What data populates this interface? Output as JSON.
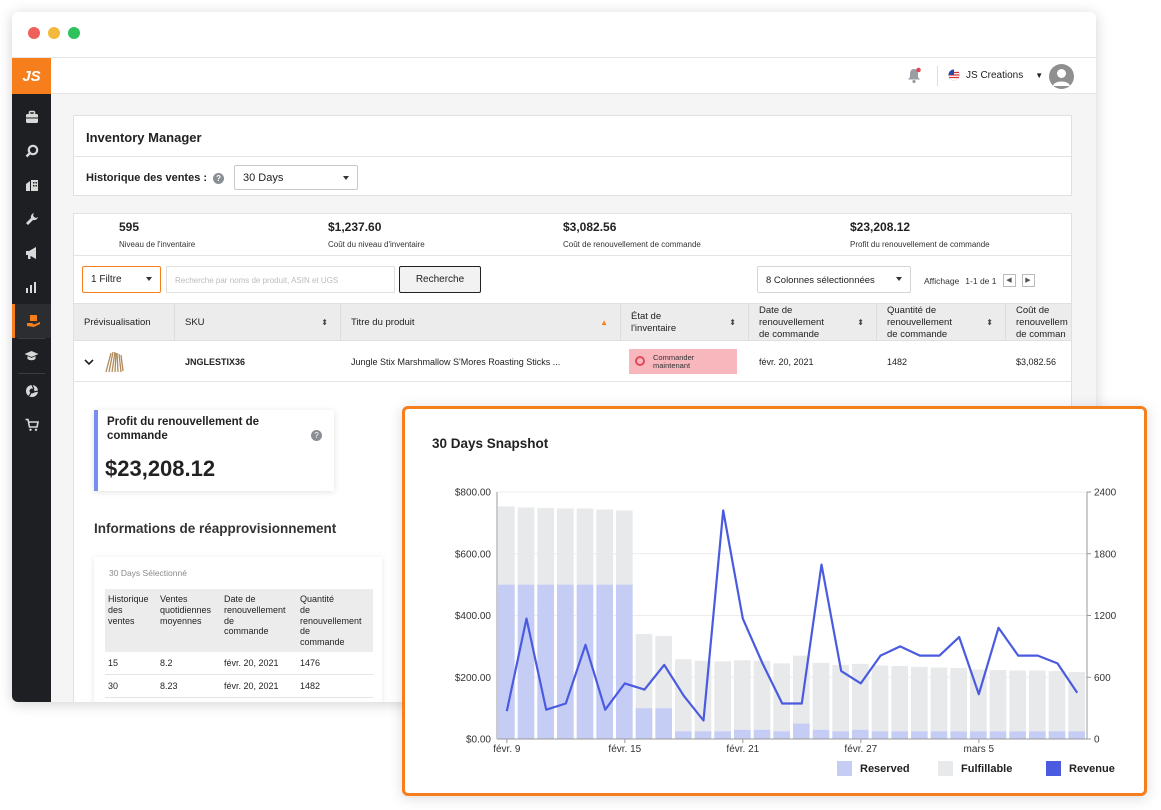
{
  "app": {
    "logo_text": "JS",
    "store_name": "JS Creations",
    "colors": {
      "accent": "#f67e1d",
      "sidebar": "#1d1f23",
      "reserved": "#c6cdf5",
      "fulfillable": "#e8e9eb",
      "revenue": "#4b5be0"
    }
  },
  "sidebar": {
    "items": [
      {
        "icon": "suitcase-icon"
      },
      {
        "icon": "search-icon"
      },
      {
        "icon": "building-icon"
      },
      {
        "icon": "wrench-icon"
      },
      {
        "icon": "megaphone-icon"
      },
      {
        "icon": "bar-chart-icon"
      },
      {
        "icon": "inventory-hand-icon",
        "active": true
      },
      {
        "icon": "graduation-cap-icon"
      },
      {
        "icon": "aperture-icon"
      },
      {
        "icon": "cart-icon"
      }
    ]
  },
  "header": {
    "title": "Inventory Manager",
    "history_label": "Historique des ventes :",
    "history_value": "30 Days"
  },
  "stats": [
    {
      "value": "595",
      "label": "Niveau de l'inventaire"
    },
    {
      "value": "$1,237.60",
      "label": "Coût du niveau d'inventaire"
    },
    {
      "value": "$3,082.56",
      "label": "Coût de renouvellement de commande"
    },
    {
      "value": "$23,208.12",
      "label": "Profit du renouvellement de commande"
    }
  ],
  "toolbar": {
    "filter_label": "1 Filtre",
    "search_placeholder": "Recherche par noms de produit, ASIN et UGS",
    "search_button": "Recherche",
    "columns_label": "8 Colonnes sélectionnées",
    "display_label": "Affichage",
    "display_range": "1-1 de 1"
  },
  "table": {
    "headers": {
      "preview": "Prévisualisation",
      "sku": "SKU",
      "title": "Titre du produit",
      "state_1": "État de",
      "state_2": "l'inventaire",
      "date_1": "Date de",
      "date_2": "renouvellement",
      "date_3": "de commande",
      "qty_1": "Quantité de",
      "qty_2": "renouvellement",
      "qty_3": "de commande",
      "cost_1": "Coût de",
      "cost_2": "renouvellem",
      "cost_3": "de comman"
    },
    "row": {
      "sku": "JNGLESTIX36",
      "title": "Jungle Stix Marshmallow S'Mores Roasting Sticks ...",
      "state_1": "Commander",
      "state_2": "maintenant",
      "date": "févr. 20, 2021",
      "qty": "1482",
      "cost": "$3,082.56"
    }
  },
  "profit_card": {
    "title": "Profit du renouvellement de commande",
    "value": "$23,208.12"
  },
  "restock": {
    "title": "Informations de réapprovisionnement",
    "selected": "30 Days Sélectionné",
    "headers": [
      [
        "Historique",
        "des",
        "ventes"
      ],
      [
        "Ventes",
        "quotidiennes",
        "moyennes"
      ],
      [
        "Date de",
        "renouvellement",
        "de",
        "commande"
      ],
      [
        "Quantité",
        "de",
        "renouvellement",
        "de",
        "commande"
      ]
    ],
    "rows": [
      [
        "15",
        "8.2",
        "févr. 20, 2021",
        "1476"
      ],
      [
        "30",
        "8.23",
        "févr. 20, 2021",
        "1482"
      ]
    ]
  },
  "chart_data": {
    "type": "bar",
    "title": "30 Days Snapshot",
    "x_tick_labels": [
      "févr. 9",
      "févr. 15",
      "févr. 21",
      "févr. 27",
      "mars 5"
    ],
    "x_tick_indices": [
      1,
      7,
      13,
      19,
      25
    ],
    "y_left": {
      "ticks": [
        "$0.00",
        "$200.00",
        "$400.00",
        "$600.00",
        "$800.00"
      ],
      "range": [
        0,
        800
      ]
    },
    "y_right": {
      "ticks": [
        "0",
        "600",
        "1200",
        "1800",
        "2400"
      ],
      "range": [
        0,
        2400
      ]
    },
    "legend_position": "bottom-right",
    "series": [
      {
        "name": "Reserved",
        "type": "bar",
        "axis": "right",
        "values": [
          1500,
          1500,
          1500,
          1500,
          1500,
          1500,
          1500,
          300,
          300,
          75,
          75,
          75,
          90,
          90,
          75,
          150,
          90,
          75,
          90,
          75,
          75,
          75,
          75,
          75,
          75,
          75,
          75,
          75,
          75,
          75
        ]
      },
      {
        "name": "Fulfillable",
        "type": "bar",
        "axis": "right",
        "values": [
          760,
          750,
          745,
          740,
          740,
          730,
          720,
          720,
          700,
          700,
          685,
          680,
          675,
          670,
          660,
          660,
          650,
          645,
          640,
          640,
          635,
          625,
          620,
          615,
          600,
          595,
          590,
          590,
          585,
          575
        ]
      },
      {
        "name": "Revenue",
        "type": "line",
        "axis": "left",
        "values": [
          90,
          390,
          95,
          115,
          305,
          95,
          180,
          160,
          240,
          140,
          60,
          740,
          390,
          245,
          115,
          115,
          565,
          220,
          180,
          270,
          300,
          270,
          270,
          330,
          145,
          360,
          270,
          270,
          245,
          150
        ]
      }
    ]
  }
}
